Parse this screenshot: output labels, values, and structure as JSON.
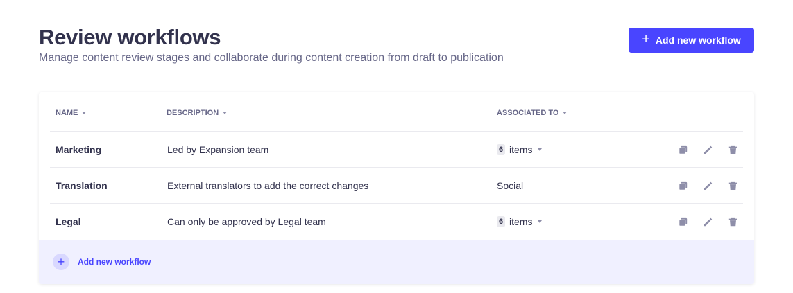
{
  "header": {
    "title": "Review workflows",
    "subtitle": "Manage content review stages and collaborate during content creation from draft to publication",
    "add_button_label": "Add new workflow",
    "add_button_icon": "plus-icon"
  },
  "table": {
    "columns": [
      "NAME",
      "DESCRIPTION",
      "ASSOCIATED TO"
    ],
    "rows": [
      {
        "name": "Marketing",
        "description": "Led by Expansion team",
        "assoc_count": "6",
        "assoc_text": "items",
        "assoc_dropdown": true
      },
      {
        "name": "Translation",
        "description": "External translators to add the correct changes",
        "assoc_count": "",
        "assoc_text": "Social",
        "assoc_dropdown": false
      },
      {
        "name": "Legal",
        "description": "Can only be approved by Legal team",
        "assoc_count": "6",
        "assoc_text": "items",
        "assoc_dropdown": true
      }
    ],
    "row_actions": [
      "duplicate-icon",
      "pencil-icon",
      "trash-icon"
    ]
  },
  "footer": {
    "add_label": "Add new workflow"
  },
  "colors": {
    "primary": "#4945ff",
    "footer_bg": "#f0f0ff",
    "text_primary": "#32324d",
    "text_secondary": "#666687"
  }
}
